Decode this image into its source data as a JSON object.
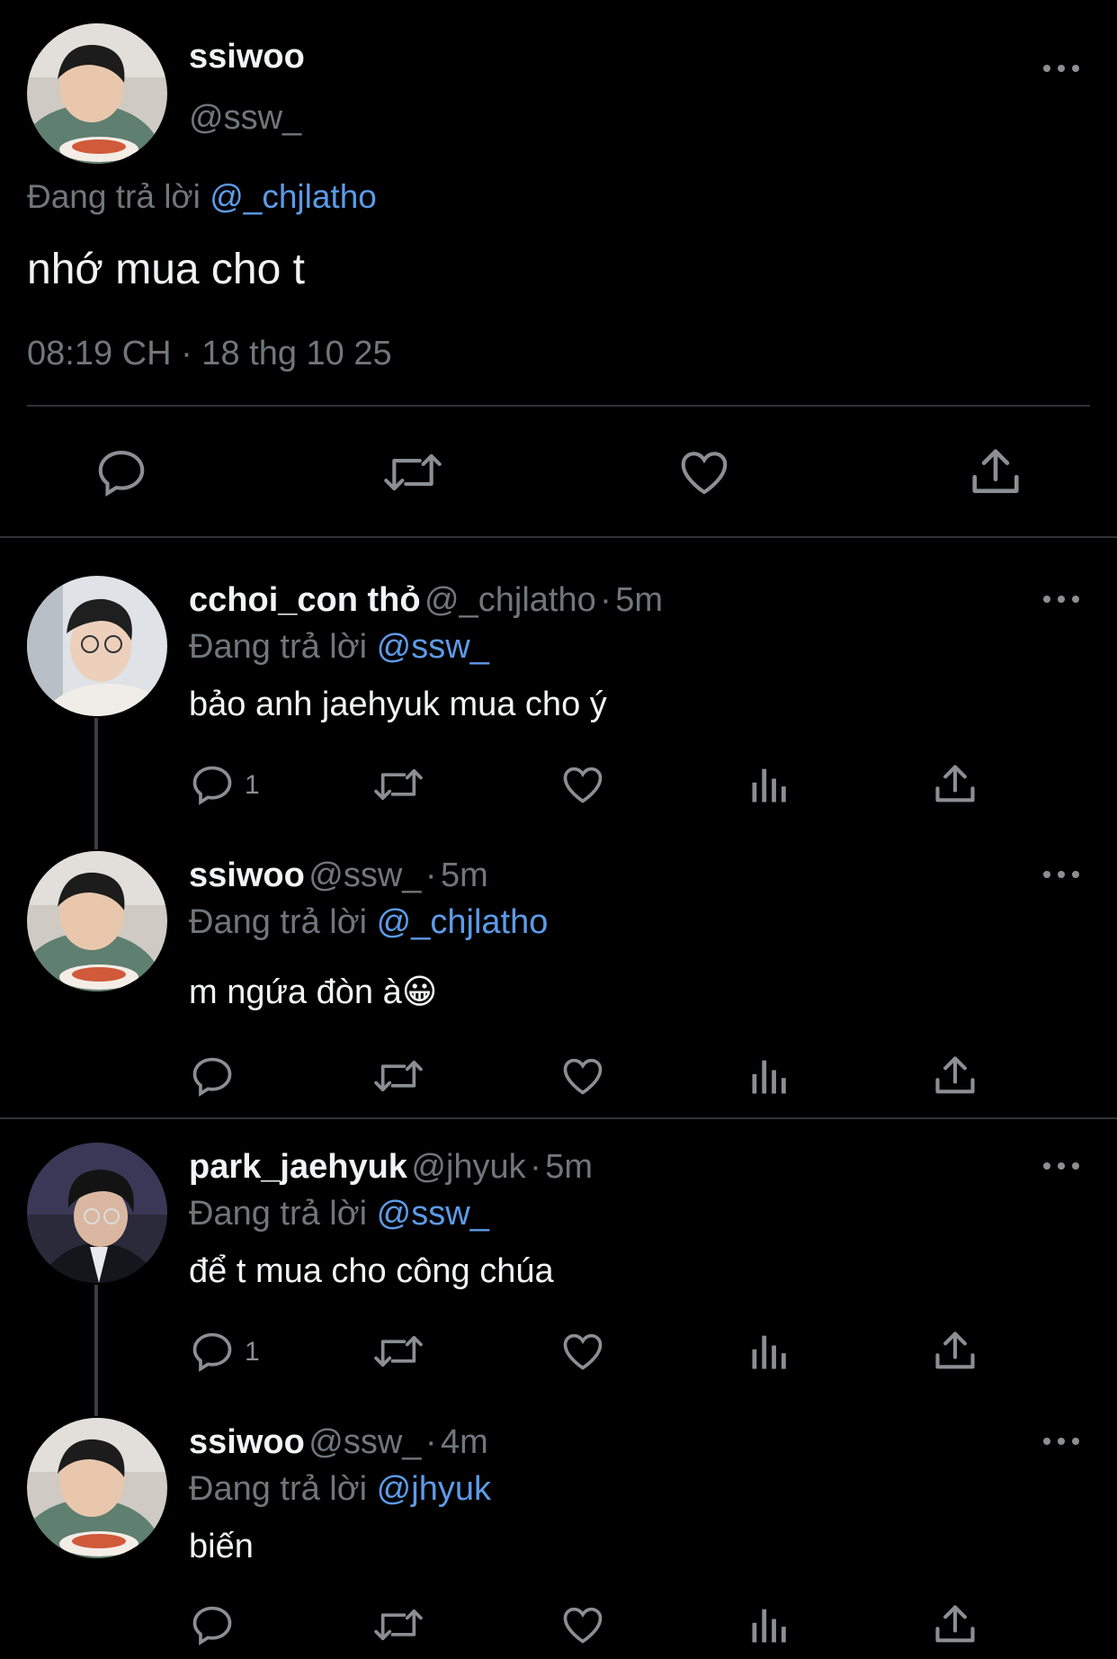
{
  "main_tweet": {
    "display_name": "ssiwoo",
    "handle": "@ssw_",
    "reply_prefix": "Đang trả lời",
    "reply_to": "@_chjlatho",
    "text": "nhớ mua cho t",
    "timestamp": "08:19 CH · 18 thg 10 25"
  },
  "actions": {
    "reply_icon": "reply-icon",
    "retweet_icon": "retweet-icon",
    "like_icon": "like-icon",
    "views_icon": "views-icon",
    "share_icon": "share-icon"
  },
  "replies": [
    {
      "display_name": "cchoi_con thỏ",
      "handle": "@_chjlatho",
      "sep": "·",
      "time": "5m",
      "reply_prefix": "Đang trả lời",
      "reply_to": "@ssw_",
      "text": "bảo anh jaehyuk mua cho ý",
      "reply_count": "1"
    },
    {
      "display_name": "ssiwoo",
      "handle": "@ssw_",
      "sep": "·",
      "time": "5m",
      "reply_prefix": "Đang trả lời",
      "reply_to": "@_chjlatho",
      "text": "m ngứa đòn à😀",
      "reply_count": ""
    },
    {
      "display_name": "park_jaehyuk",
      "handle": "@jhyuk",
      "sep": "·",
      "time": "5m",
      "reply_prefix": "Đang trả lời",
      "reply_to": "@ssw_",
      "text": "để t mua cho công chúa",
      "reply_count": "1"
    },
    {
      "display_name": "ssiwoo",
      "handle": "@ssw_",
      "sep": "·",
      "time": "4m",
      "reply_prefix": "Đang trả lời",
      "reply_to": "@jhyuk",
      "text": "biến",
      "reply_count": ""
    }
  ],
  "colors": {
    "background": "#000000",
    "link": "#5d9be8",
    "muted": "#71767b",
    "text": "#e7e9ea"
  }
}
